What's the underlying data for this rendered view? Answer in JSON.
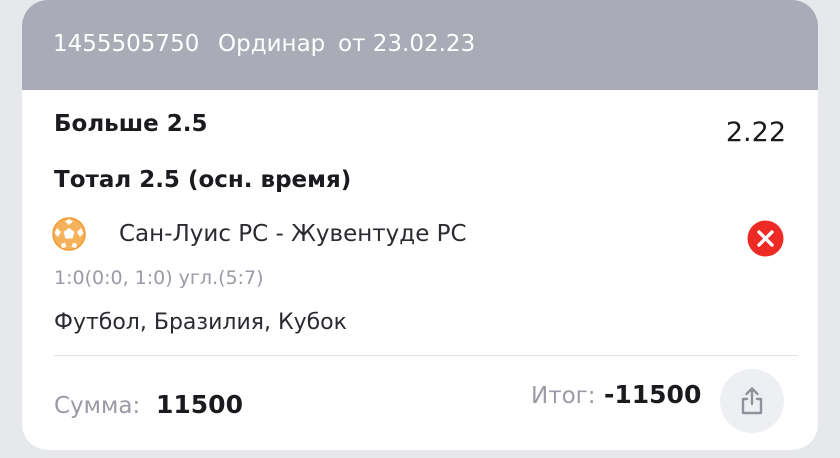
{
  "header": {
    "bet_id": "1455505750",
    "bet_type": "Ординар",
    "date": "от 23.02.23"
  },
  "bet": {
    "outcome": "Больше 2.5",
    "odds": "2.22",
    "market": "Тотал 2.5 (осн. время)",
    "match": "Сан-Луис РС - Жувентуде РС",
    "score": "1:0(0:0, 1:0) угл.(5:7)",
    "league": "Футбол, Бразилия, Кубок",
    "status_icon": "lost-x-icon",
    "sport_icon": "football-icon"
  },
  "footer": {
    "stake_label": "Сумма:",
    "stake_value": "11500",
    "result_label": "Итог:",
    "result_value": "-11500",
    "share_icon": "share-icon"
  },
  "colors": {
    "header_bg": "#a9abb6",
    "lost_red": "#ee2a24",
    "ball_orange": "#f39a35",
    "muted_text": "#9a9ba6"
  }
}
